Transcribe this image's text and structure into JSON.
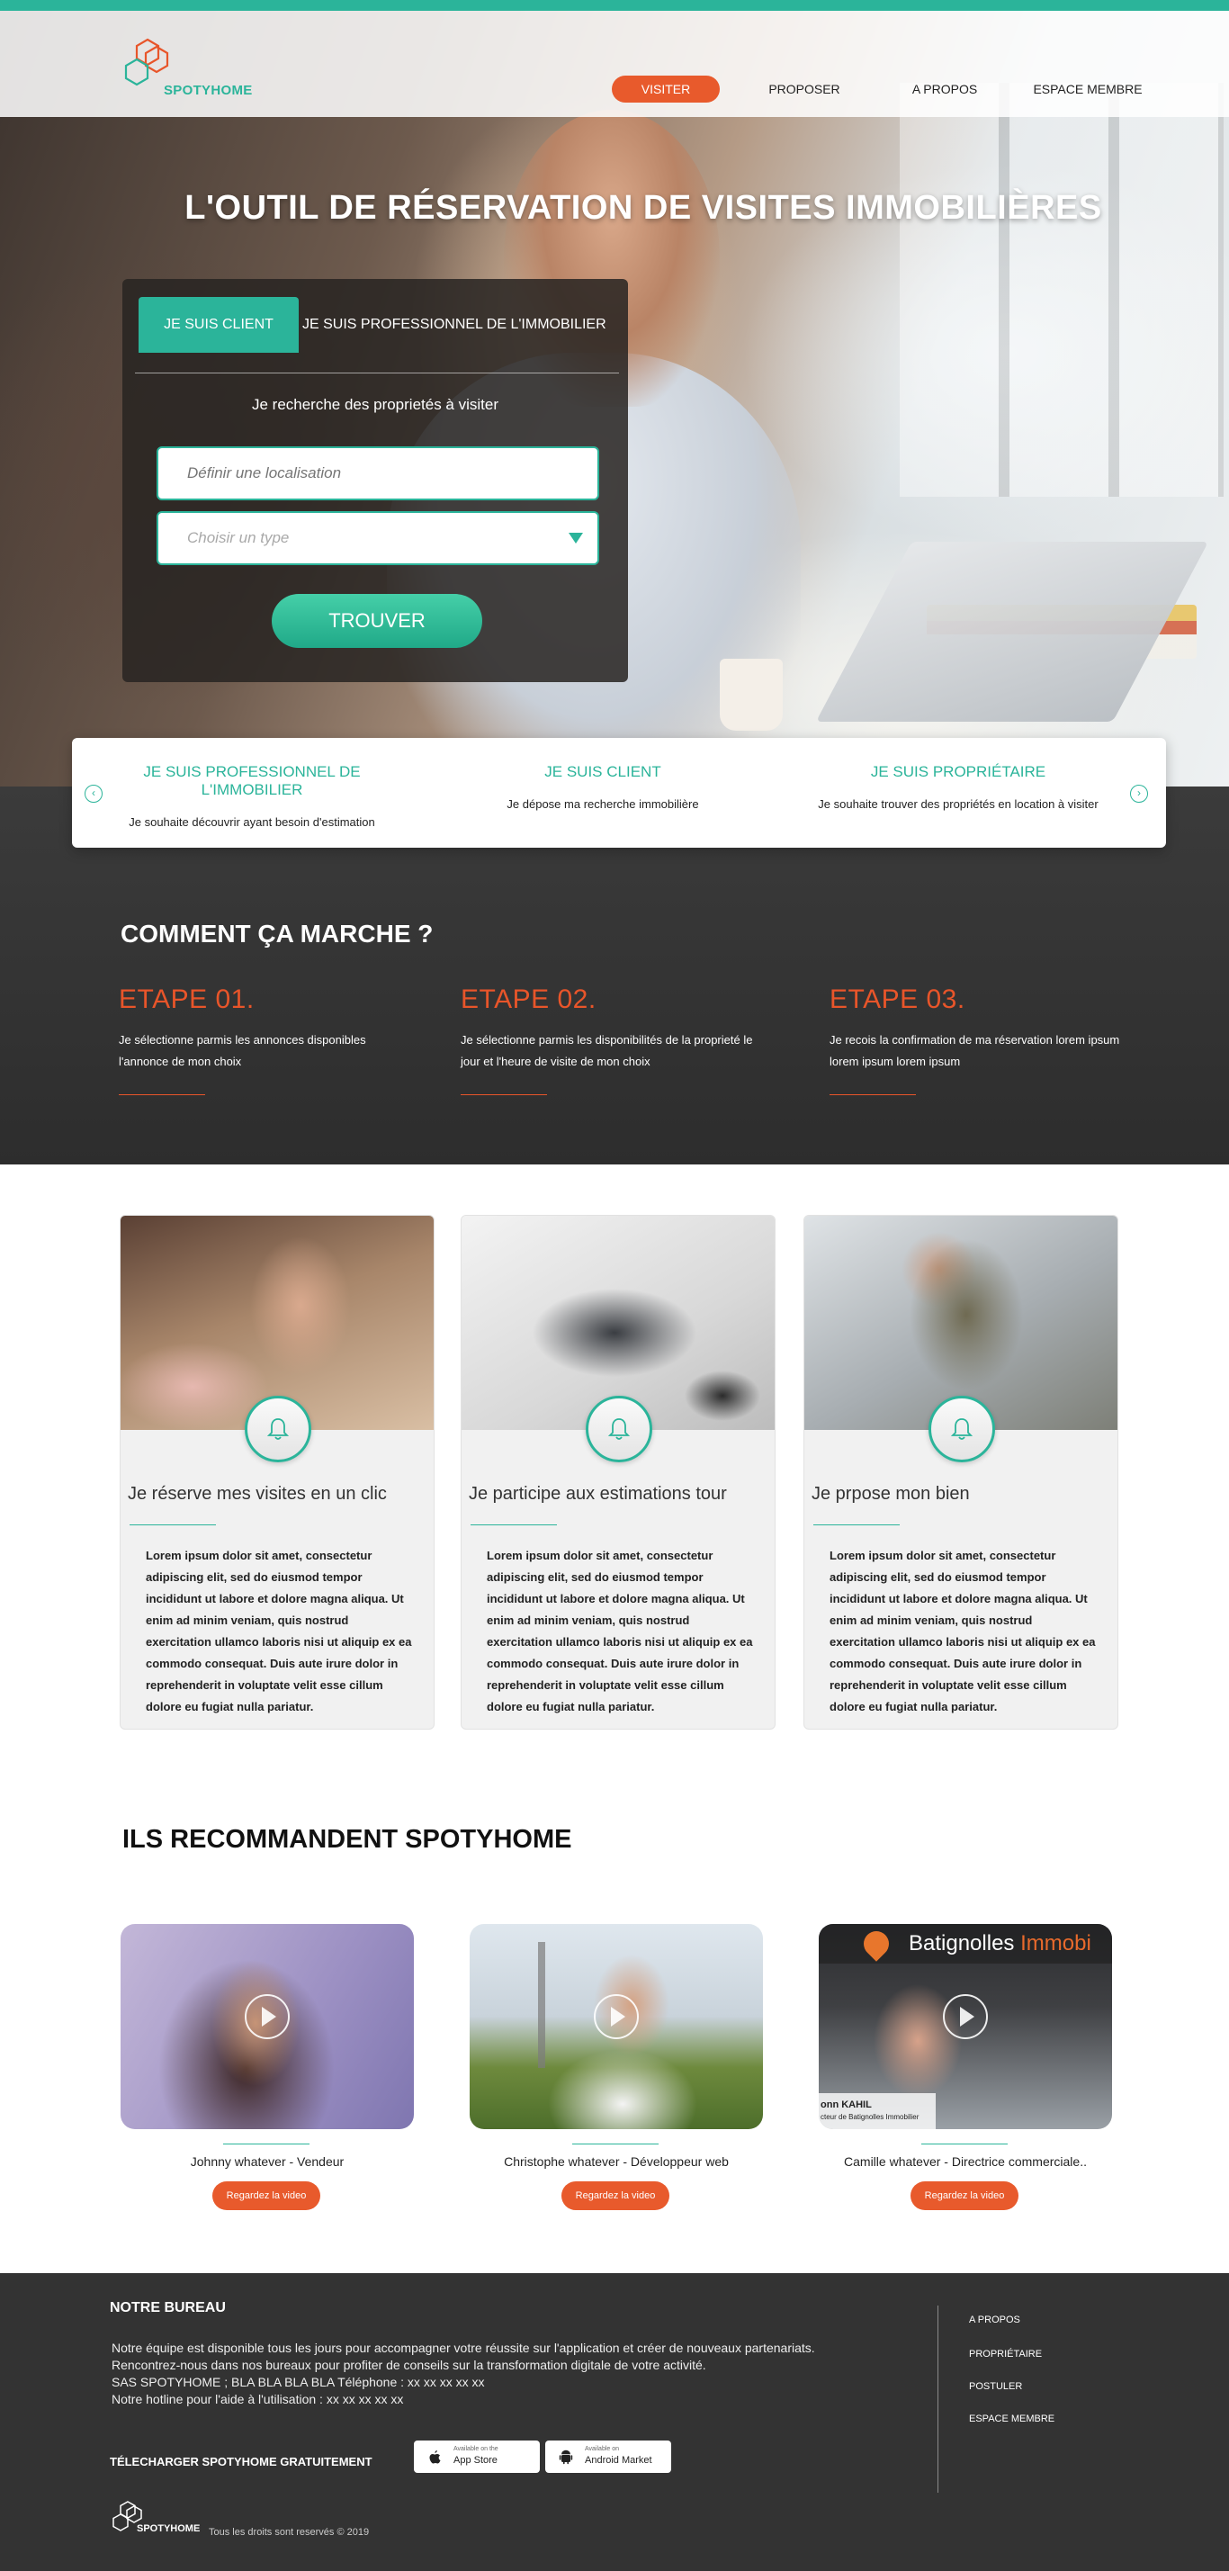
{
  "brand": {
    "name": "SPOTYHOME"
  },
  "nav": {
    "items": [
      {
        "label": "VISITER",
        "active": true
      },
      {
        "label": "PROPOSER",
        "active": false
      },
      {
        "label": "A PROPOS",
        "active": false
      },
      {
        "label": "ESPACE MEMBRE",
        "active": false
      }
    ]
  },
  "hero": {
    "title": "L'OUTIL DE RÉSERVATION DE VISITES IMMOBILIÈRES"
  },
  "search": {
    "tabs": [
      {
        "label": "JE SUIS CLIENT",
        "active": true
      },
      {
        "label": "JE SUIS PROFESSIONNEL DE L'IMMOBILIER",
        "active": false
      }
    ],
    "subtitle": "Je recherche des proprietés à visiter",
    "location_placeholder": "Définir une localisation",
    "type_placeholder": "Choisir un type",
    "submit_label": "TROUVER"
  },
  "profiles": [
    {
      "title": "JE SUIS PROFESSIONNEL DE L'IMMOBILIER",
      "desc": "Je souhaite découvrir ayant besoin d'estimation"
    },
    {
      "title": "JE SUIS CLIENT",
      "desc": "Je dépose ma recherche immobilière"
    },
    {
      "title": "JE SUIS PROPRIÉTAIRE",
      "desc": "Je souhaite trouver des propriétés en location à visiter"
    }
  ],
  "how": {
    "title": "COMMENT ÇA MARCHE ?",
    "steps": [
      {
        "title": "ETAPE 01.",
        "text": "Je sélectionne parmis les annonces disponibles l'annonce de mon choix"
      },
      {
        "title": "ETAPE 02.",
        "text": "Je sélectionne parmis les disponibilités de la proprieté le jour et l'heure de visite de mon choix"
      },
      {
        "title": "ETAPE 03.",
        "text": "Je recois la confirmation de ma réservation lorem ipsum lorem ipsum lorem ipsum"
      }
    ]
  },
  "features": [
    {
      "title": "Je réserve mes visites en un clic",
      "icon": "bell-icon",
      "text": "Lorem ipsum dolor sit amet, consectetur adipiscing elit, sed do eiusmod tempor incididunt ut labore et dolore magna aliqua. Ut enim ad minim veniam, quis nostrud exercitation ullamco laboris nisi ut aliquip ex ea commodo consequat. Duis aute irure dolor in reprehenderit in voluptate velit esse cillum dolore eu fugiat nulla pariatur."
    },
    {
      "title": "Je participe aux estimations tour",
      "icon": "bell-icon",
      "text": "Lorem ipsum dolor sit amet, consectetur adipiscing elit, sed do eiusmod tempor incididunt ut labore et dolore magna aliqua. Ut enim ad minim veniam, quis nostrud exercitation ullamco laboris nisi ut aliquip ex ea commodo consequat. Duis aute irure dolor in reprehenderit in voluptate velit esse cillum dolore eu fugiat nulla pariatur."
    },
    {
      "title": "Je prpose mon bien",
      "icon": "bell-icon",
      "text": "Lorem ipsum dolor sit amet, consectetur adipiscing elit, sed do eiusmod tempor incididunt ut labore et dolore magna aliqua. Ut enim ad minim veniam, quis nostrud exercitation ullamco laboris nisi ut aliquip ex ea commodo consequat. Duis aute irure dolor in reprehenderit in voluptate velit esse cillum dolore eu fugiat nulla pariatur."
    }
  ],
  "testimonials": {
    "title": "ILS RECOMMANDENT SPOTYHOME",
    "items": [
      {
        "name": "Johnny whatever - Vendeur",
        "button": "Regardez la video"
      },
      {
        "name": "Christophe whatever - Développeur web",
        "button": "Regardez la video"
      },
      {
        "name": "Camille whatever - Directrice commerciale..",
        "button": "Regardez la video",
        "video_brand": [
          "Batignolles",
          "Immobi"
        ],
        "video_caption": [
          "onn KAHIL",
          "cteur de Batignolles Immobilier"
        ]
      }
    ]
  },
  "footer": {
    "title": "NOTRE BUREAU",
    "lines": [
      "Notre équipe est disponible tous les jours  pour accompagner votre réussite sur l'application et créer de nouveaux partenariats.",
      "Rencontrez-nous dans nos bureaux pour profiter de conseils sur la transformation digitale de votre activité.",
      "SAS SPOTYHOME ; BLA BLA BLA BLA Téléphone : xx xx xx xx xx",
      "Notre hotline pour l'aide à l'utilisation : xx xx xx xx xx"
    ],
    "links": [
      "A PROPOS",
      "PROPRIÉTAIRE",
      "POSTULER",
      "ESPACE MEMBRE"
    ],
    "download_label": "TÉLECHARGER SPOTYHOME GRATUITEMENT",
    "stores": [
      {
        "small": "Available on the",
        "name": "App Store",
        "icon": "apple-icon"
      },
      {
        "small": "Available on",
        "name": "Android Market",
        "icon": "android-icon"
      }
    ],
    "rights": "Tous les droits sont reservés © 2019"
  },
  "colors": {
    "accent": "#2bb49a",
    "orange": "#e85a2c",
    "dark": "#333333"
  }
}
